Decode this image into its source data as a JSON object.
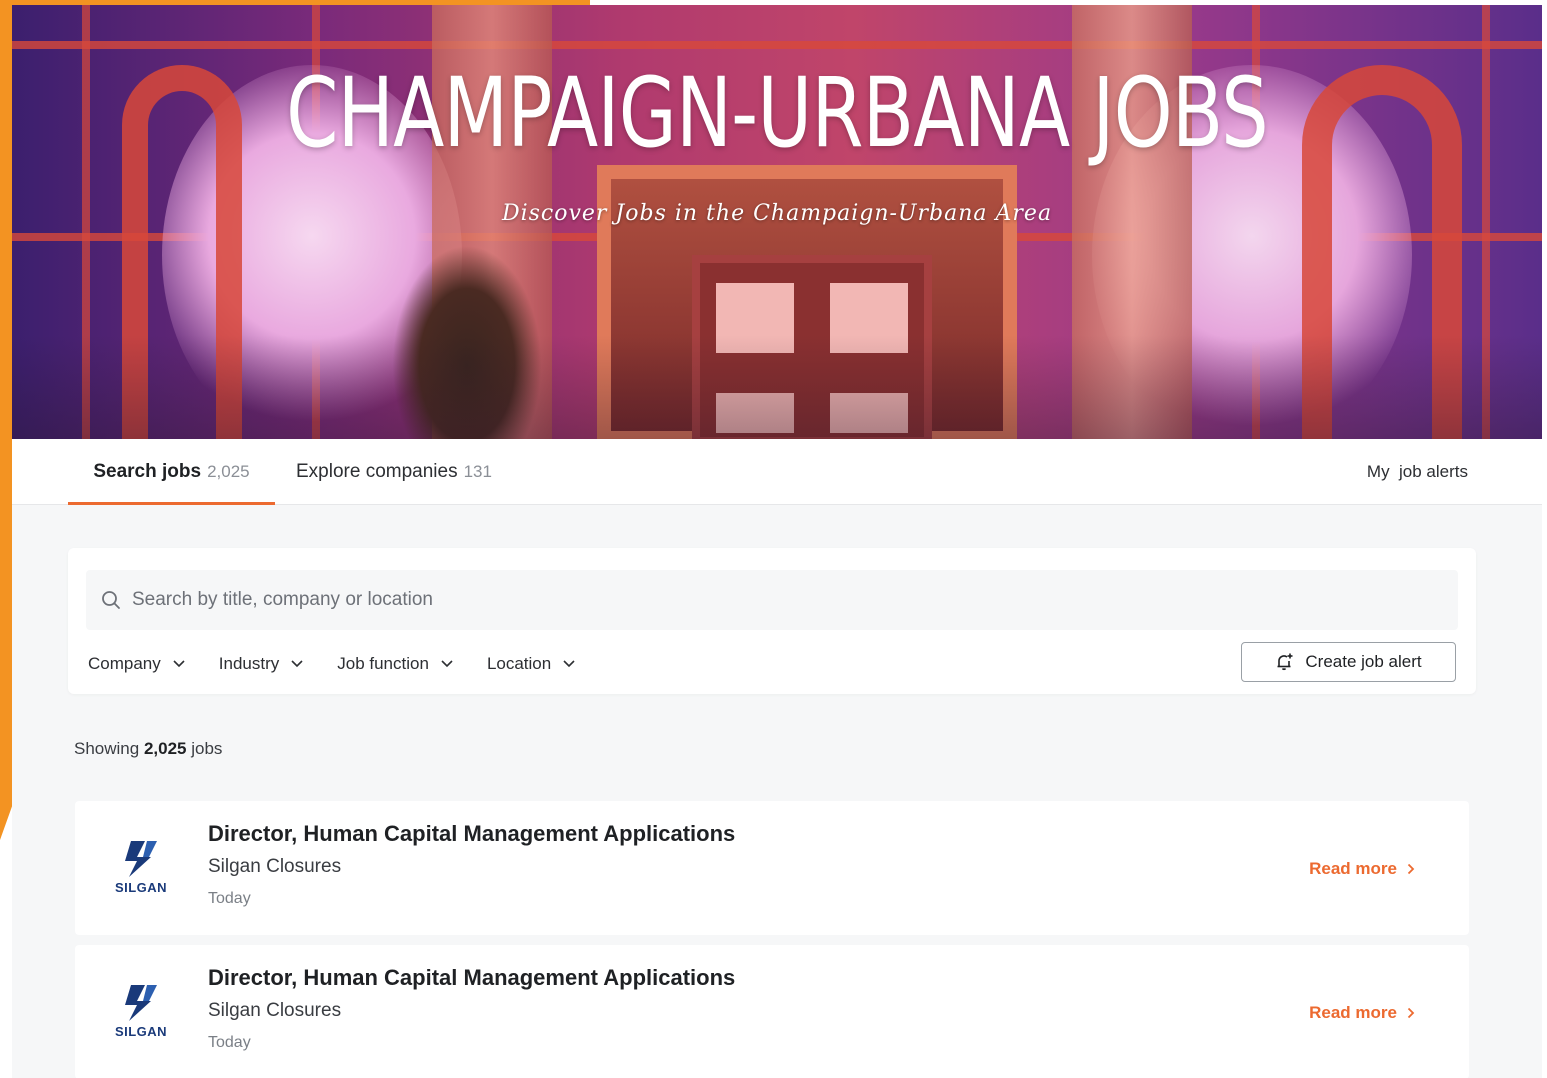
{
  "hero": {
    "title": "CHAMPAIGN-URBANA JOBS",
    "subtitle": "Discover Jobs in the Champaign-Urbana Area"
  },
  "tabs": {
    "search_label": "Search jobs",
    "search_count": "2,025",
    "explore_label": "Explore companies",
    "explore_count": "131",
    "alerts_label": "My  job alerts"
  },
  "search": {
    "placeholder": "Search by title, company or location",
    "value": ""
  },
  "filters": [
    {
      "label": "Company"
    },
    {
      "label": "Industry"
    },
    {
      "label": "Job function"
    },
    {
      "label": "Location"
    }
  ],
  "create_alert_label": "Create job alert",
  "results": {
    "prefix": "Showing",
    "count": "2,025",
    "suffix": "jobs"
  },
  "jobs": [
    {
      "title": "Director, Human Capital Management Applications",
      "company": "Silgan Closures",
      "date": "Today",
      "logo_text": "SILGAN",
      "cta": "Read more"
    },
    {
      "title": "Director, Human Capital Management Applications",
      "company": "Silgan Closures",
      "date": "Today",
      "logo_text": "SILGAN",
      "cta": "Read more"
    }
  ],
  "colors": {
    "accent": "#ec6a30",
    "page_accent": "#f39322",
    "logo_blue": "#1a3a7a"
  },
  "icons": [
    "search-icon",
    "chevron-down-icon",
    "bell-plus-icon",
    "chevron-right-icon",
    "silgan-logo"
  ]
}
